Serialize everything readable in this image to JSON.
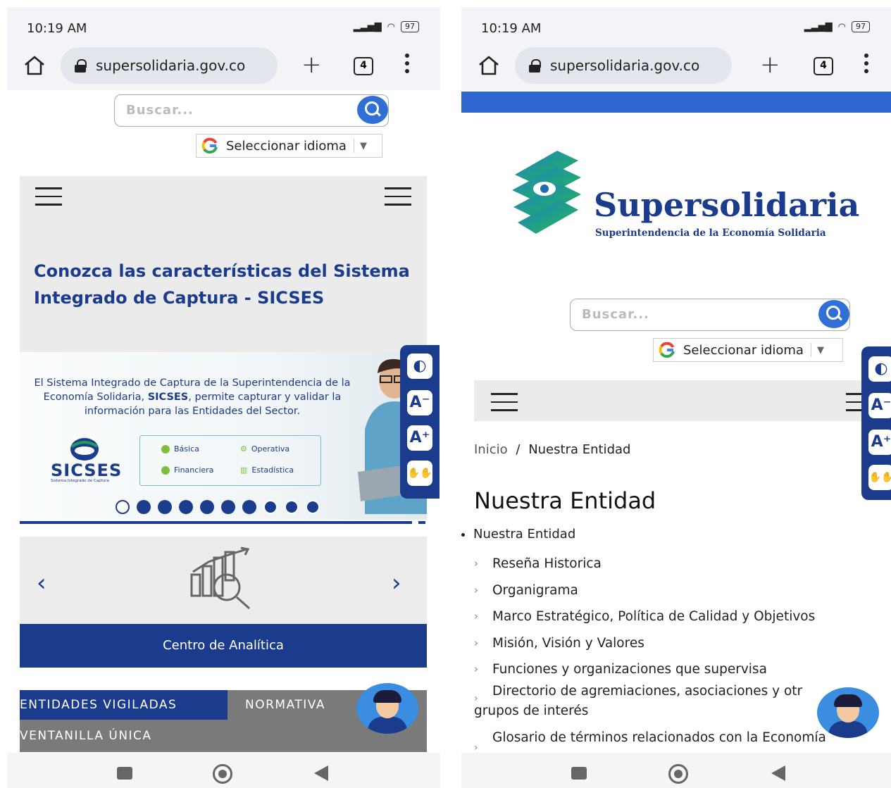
{
  "status": {
    "time": "10:19 AM",
    "battery": "97"
  },
  "browser": {
    "url": "supersolidaria.gov.co",
    "tab_count": "4"
  },
  "search": {
    "placeholder": "Buscar..."
  },
  "language": {
    "label": "Seleccionar idioma"
  },
  "left": {
    "hero_title": "Conozca las características del Sistema Integrado de Captura - SICSES",
    "banner": {
      "text_pre": "El Sistema Integrado de Captura de  la Superintendencia de la Economía Solidaria, ",
      "text_bold": "SICSES",
      "text_post": ", permite capturar y validar la información para las Entidades del Sector.",
      "logo": "SICSES",
      "logo_sub": "Sistema Integrado de Captura",
      "chips": [
        "Básica",
        "Operativa",
        "Financiera",
        "Estadística"
      ]
    },
    "carousel": {
      "dot_count": 10,
      "active_index": 0
    },
    "card_label": "Centro de Analítica",
    "tabs": [
      "ENTIDADES VIGILADAS",
      "NORMATIVA",
      "VENTANILLA ÚNICA"
    ]
  },
  "right": {
    "brand": {
      "name": "Supersolidaria",
      "tagline": "Superintendencia de la Economía Solidaria"
    },
    "breadcrumb": {
      "home": "Inicio",
      "sep": "/",
      "current": "Nuestra Entidad"
    },
    "page_title": "Nuestra Entidad",
    "root_item": "Nuestra Entidad",
    "menu": [
      "Reseña Historica",
      "Organigrama",
      "Marco Estratégico, Política de Calidad y Objetivos",
      "Misión, Visión y Valores",
      "Funciones y organizaciones que supervisa"
    ],
    "menu_wrap1_a": "Directorio de agremiaciones, asociaciones y otr",
    "menu_wrap1_b": "grupos de interés",
    "menu_wrap2": "Glosario de términos relacionados con la Economía"
  },
  "a11y": {
    "contrast": "◐",
    "font_down": "A⁻",
    "font_up": "A⁺",
    "sign": "✋✋"
  },
  "colors": {
    "brand_blue": "#1b3b8c",
    "accent_blue": "#2f6fd6",
    "bar_blue": "#2f66d0",
    "green": "#1f9e5b"
  }
}
